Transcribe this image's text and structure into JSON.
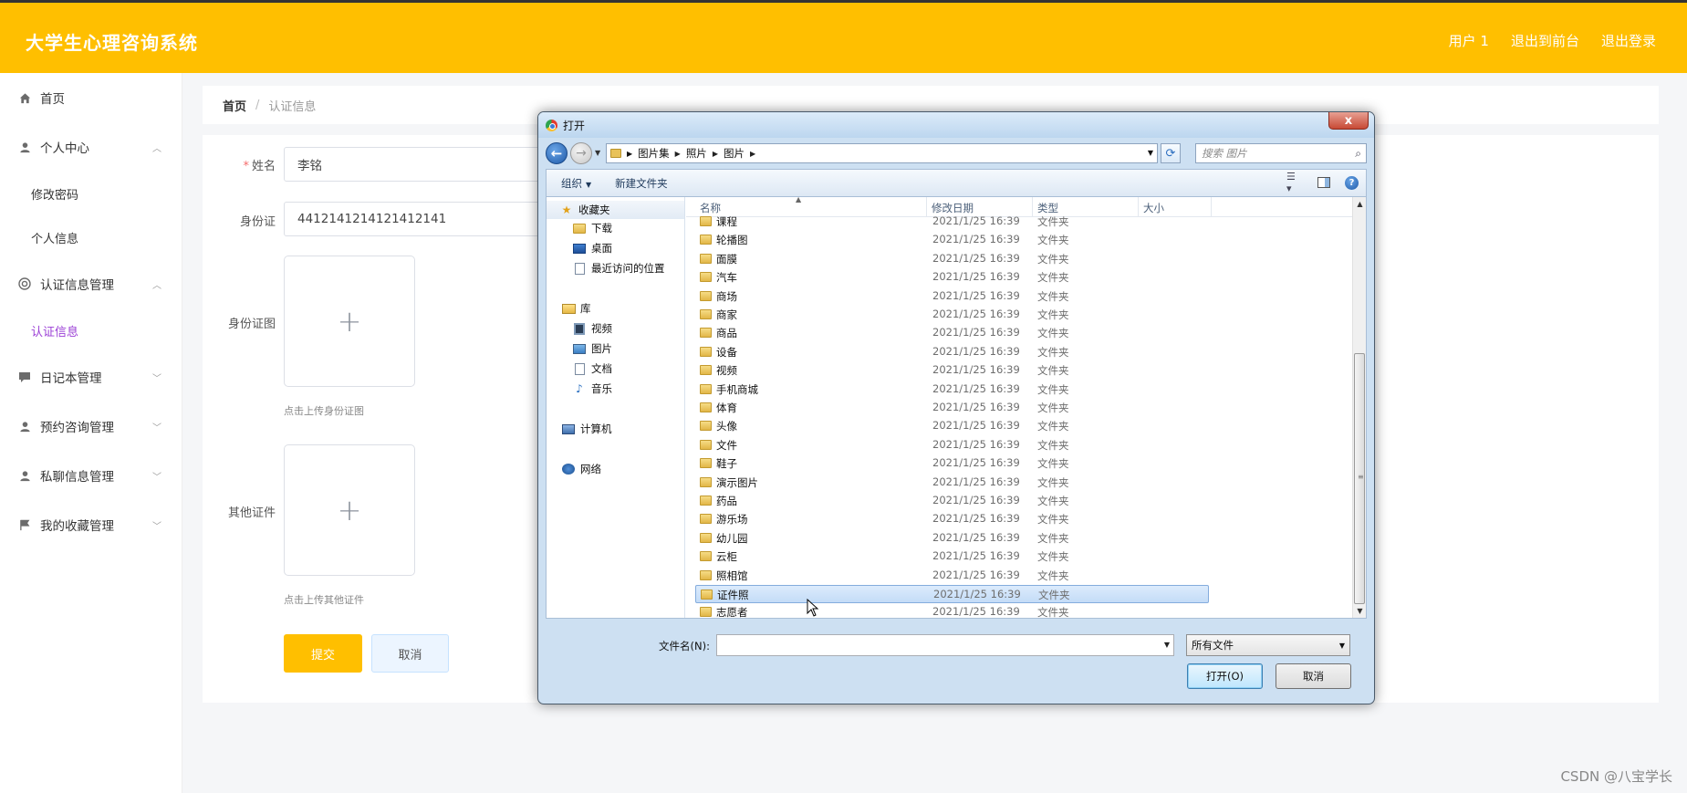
{
  "app": {
    "title": "大学生心理咨询系统",
    "header_links": [
      "用户 1",
      "退出到前台",
      "退出登录"
    ]
  },
  "sidebar": {
    "items": [
      {
        "label": "首页",
        "icon": "home-icon"
      },
      {
        "label": "个人中心",
        "icon": "user-icon",
        "expanded": true
      },
      {
        "label": "修改密码",
        "sub": true
      },
      {
        "label": "个人信息",
        "sub": true
      },
      {
        "label": "认证信息管理",
        "icon": "lifebuoy-icon",
        "expanded": true
      },
      {
        "label": "认证信息",
        "sub": true,
        "active": true
      },
      {
        "label": "日记本管理",
        "icon": "chat-icon",
        "expanded": false
      },
      {
        "label": "预约咨询管理",
        "icon": "user-icon",
        "expanded": false
      },
      {
        "label": "私聊信息管理",
        "icon": "user-icon",
        "expanded": false
      },
      {
        "label": "我的收藏管理",
        "icon": "flag-icon",
        "expanded": false
      }
    ]
  },
  "breadcrumb": {
    "home": "首页",
    "sep": "/",
    "current": "认证信息"
  },
  "form": {
    "name_label": "姓名",
    "required_mark": "*",
    "name_value": "李铭",
    "id_label": "身份证",
    "id_value": "4412141214121412141",
    "id_image_label": "身份证图",
    "id_image_tip": "点击上传身份证图",
    "other_label": "其他证件",
    "other_tip": "点击上传其他证件",
    "upload_plus": "+",
    "submit": "提交",
    "cancel": "取消"
  },
  "dialog": {
    "title": "打开",
    "close": "x",
    "address_crumbs": [
      "图片集",
      "照片",
      "图片"
    ],
    "search_placeholder": "搜索 图片",
    "toolbar": {
      "organize": "组织",
      "new_folder": "新建文件夹"
    },
    "nav_pane": {
      "favorites": "收藏夹",
      "downloads": "下载",
      "desktop": "桌面",
      "recent": "最近访问的位置",
      "library": "库",
      "videos": "视频",
      "pictures": "图片",
      "documents": "文档",
      "music": "音乐",
      "computer": "计算机",
      "network": "网络"
    },
    "columns": {
      "name": "名称",
      "date": "修改日期",
      "type": "类型",
      "size": "大小"
    },
    "files": [
      {
        "name": "课程",
        "date": "2021/1/25 16:39",
        "type": "文件夹"
      },
      {
        "name": "轮播图",
        "date": "2021/1/25 16:39",
        "type": "文件夹"
      },
      {
        "name": "面膜",
        "date": "2021/1/25 16:39",
        "type": "文件夹"
      },
      {
        "name": "汽车",
        "date": "2021/1/25 16:39",
        "type": "文件夹"
      },
      {
        "name": "商场",
        "date": "2021/1/25 16:39",
        "type": "文件夹"
      },
      {
        "name": "商家",
        "date": "2021/1/25 16:39",
        "type": "文件夹"
      },
      {
        "name": "商品",
        "date": "2021/1/25 16:39",
        "type": "文件夹"
      },
      {
        "name": "设备",
        "date": "2021/1/25 16:39",
        "type": "文件夹"
      },
      {
        "name": "视频",
        "date": "2021/1/25 16:39",
        "type": "文件夹"
      },
      {
        "name": "手机商城",
        "date": "2021/1/25 16:39",
        "type": "文件夹"
      },
      {
        "name": "体育",
        "date": "2021/1/25 16:39",
        "type": "文件夹"
      },
      {
        "name": "头像",
        "date": "2021/1/25 16:39",
        "type": "文件夹"
      },
      {
        "name": "文件",
        "date": "2021/1/25 16:39",
        "type": "文件夹"
      },
      {
        "name": "鞋子",
        "date": "2021/1/25 16:39",
        "type": "文件夹"
      },
      {
        "name": "演示图片",
        "date": "2021/1/25 16:39",
        "type": "文件夹"
      },
      {
        "name": "药品",
        "date": "2021/1/25 16:39",
        "type": "文件夹"
      },
      {
        "name": "游乐场",
        "date": "2021/1/25 16:39",
        "type": "文件夹"
      },
      {
        "name": "幼儿园",
        "date": "2021/1/25 16:39",
        "type": "文件夹"
      },
      {
        "name": "云柜",
        "date": "2021/1/25 16:39",
        "type": "文件夹"
      },
      {
        "name": "照相馆",
        "date": "2021/1/25 16:39",
        "type": "文件夹"
      },
      {
        "name": "证件照",
        "date": "2021/1/25 16:39",
        "type": "文件夹",
        "selected": true
      },
      {
        "name": "志愿者",
        "date": "2021/1/25 16:39",
        "type": "文件夹"
      }
    ],
    "filename_label": "文件名(N):",
    "filename_value": "",
    "filter": "所有文件",
    "open": "打开(O)",
    "cancel": "取消"
  },
  "watermark": "CSDN @八宝学长",
  "colors": {
    "brand": "#ffbf00",
    "active_sub": "#9b3fd6"
  }
}
